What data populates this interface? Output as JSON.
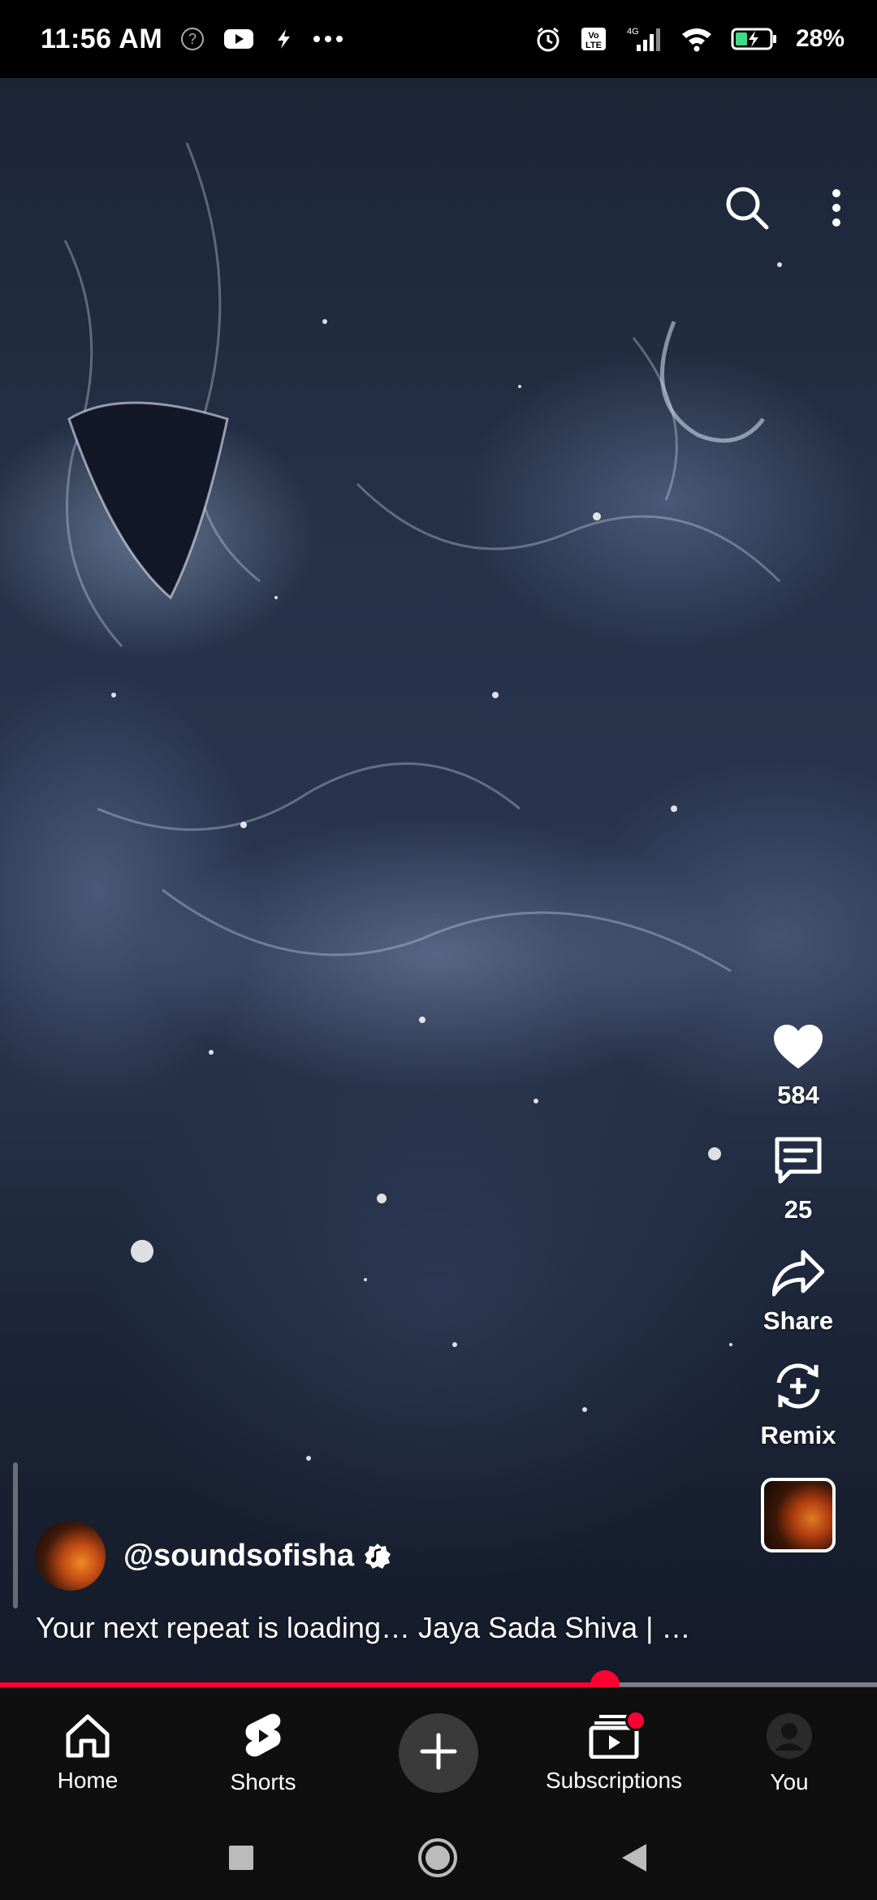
{
  "status": {
    "time": "11:56 AM",
    "battery_percent": "28%",
    "network": "4G"
  },
  "video": {
    "top_icons": [
      "search-icon",
      "more-vert-icon"
    ]
  },
  "actions": {
    "like_count": "584",
    "comment_count": "25",
    "share_label": "Share",
    "remix_label": "Remix"
  },
  "channel": {
    "handle": "@soundsofisha",
    "caption": "Your next repeat is loading…  Jaya Sada Shiva |  …"
  },
  "nav": {
    "items": [
      {
        "label": "Home"
      },
      {
        "label": "Shorts"
      },
      {
        "label": ""
      },
      {
        "label": "Subscriptions"
      },
      {
        "label": "You"
      }
    ]
  },
  "colors": {
    "accent": "#ff0033",
    "nav_bg": "#0f0f0f"
  },
  "progress": 0.69
}
